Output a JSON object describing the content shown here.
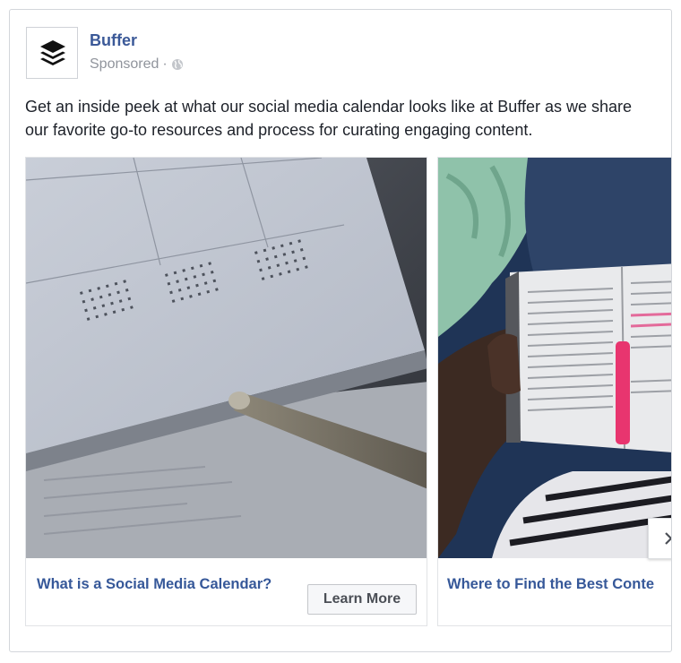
{
  "post": {
    "page_name": "Buffer",
    "sponsored_label": "Sponsored",
    "separator": "·",
    "caption": "Get an inside peek at what our social media calendar looks like at Buffer as we share our favorite go-to resources and process for curating engaging content."
  },
  "carousel": {
    "cards": [
      {
        "title": "What is a Social Media Calendar?",
        "cta": "Learn More"
      },
      {
        "title": "Where to Find the Best Conte"
      }
    ],
    "next_icon": "chevron-right-icon"
  },
  "colors": {
    "link": "#365899",
    "page_name": "#3b5998",
    "text": "#1d2129",
    "meta": "#90949c"
  }
}
